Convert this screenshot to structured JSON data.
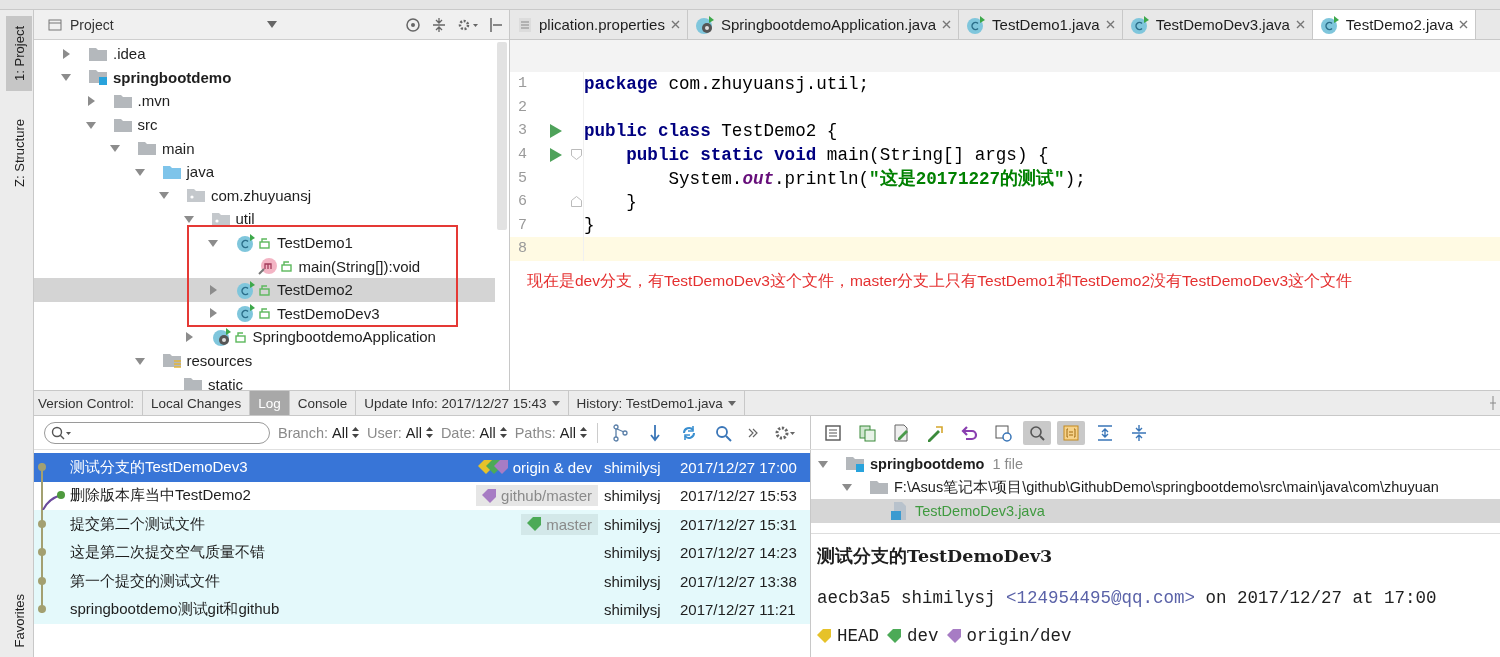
{
  "side_stripe": {
    "tabs": [
      {
        "label": "1: Project",
        "selected": true
      },
      {
        "label": "Z: Structure",
        "selected": false
      }
    ],
    "bottom_tabs": [
      {
        "label": "Favorites",
        "selected": false
      }
    ]
  },
  "project_panel": {
    "title": "Project",
    "tree": [
      {
        "label": ".idea",
        "kind": "folder",
        "expanded": false,
        "selected": false
      },
      {
        "label": "springbootdemo",
        "kind": "module",
        "expanded": true,
        "selected": false,
        "children": [
          {
            "label": ".mvn",
            "kind": "folder",
            "expanded": false,
            "selected": false
          },
          {
            "label": "src",
            "kind": "folder",
            "expanded": true,
            "selected": false,
            "children": [
              {
                "label": "main",
                "kind": "folder",
                "expanded": true,
                "selected": false,
                "children": [
                  {
                    "label": "java",
                    "kind": "source",
                    "expanded": true,
                    "selected": false,
                    "children": [
                      {
                        "label": "com.zhuyuansj",
                        "kind": "package",
                        "expanded": true,
                        "selected": false,
                        "children": [
                          {
                            "label": "util",
                            "kind": "package",
                            "expanded": true,
                            "selected": false,
                            "children": [
                              {
                                "label": "TestDemo1",
                                "kind": "class",
                                "expanded": true,
                                "selected": false,
                                "children": [
                                  {
                                    "label": "main(String[]):void",
                                    "kind": "method",
                                    "selected": false
                                  }
                                ]
                              },
                              {
                                "label": "TestDemo2",
                                "kind": "class",
                                "expanded": false,
                                "selected": true
                              },
                              {
                                "label": "TestDemoDev3",
                                "kind": "class",
                                "expanded": false,
                                "selected": false
                              }
                            ]
                          },
                          {
                            "label": "SpringbootdemoApplication",
                            "kind": "spring",
                            "expanded": false,
                            "selected": false
                          }
                        ]
                      }
                    ]
                  },
                  {
                    "label": "resources",
                    "kind": "resources",
                    "expanded": true,
                    "selected": false,
                    "children": [
                      {
                        "label": "static",
                        "kind": "folder",
                        "selected": false
                      }
                    ]
                  }
                ]
              }
            ]
          }
        ]
      }
    ]
  },
  "editor": {
    "tabs": [
      {
        "label": "plication.properties",
        "kind": "properties",
        "selected": false
      },
      {
        "label": "SpringbootdemoApplication.java",
        "kind": "spring",
        "selected": false
      },
      {
        "label": "TestDemo1.java",
        "kind": "class",
        "selected": false
      },
      {
        "label": "TestDemoDev3.java",
        "kind": "class",
        "selected": false
      },
      {
        "label": "TestDemo2.java",
        "kind": "class",
        "selected": true
      }
    ],
    "lines": [
      {
        "number": "1",
        "kind": "plain",
        "run": false,
        "current": false,
        "tokens": [
          {
            "kind": "keyword",
            "text": "package"
          },
          {
            "kind": "plain",
            "text": " com.zhuyuansj.util;"
          }
        ]
      },
      {
        "number": "2",
        "kind": "plain",
        "run": false,
        "current": false
      },
      {
        "number": "3",
        "kind": "plain",
        "run": true,
        "current": false,
        "tokens": [
          {
            "kind": "keyword",
            "text": "public"
          },
          {
            "kind": "keyword",
            "text": " class"
          },
          {
            "kind": "plain",
            "text": " TestDemo2 {"
          }
        ]
      },
      {
        "number": "4",
        "kind": "fold-start",
        "run": true,
        "current": false,
        "tokens": [
          {
            "kind": "keyword",
            "text": "    public"
          },
          {
            "kind": "keyword",
            "text": " static"
          },
          {
            "kind": "keyword",
            "text": " void"
          },
          {
            "kind": "plain",
            "text": " main(String[] args) {"
          }
        ]
      },
      {
        "number": "5",
        "kind": "plain",
        "run": false,
        "current": false,
        "tokens": [
          {
            "kind": "plain",
            "text": "        System."
          },
          {
            "kind": "field",
            "text": "out"
          },
          {
            "kind": "plain",
            "text": ".println("
          },
          {
            "kind": "string",
            "text": "\"这是20171227的测试\""
          },
          {
            "kind": "plain",
            "text": ");"
          }
        ]
      },
      {
        "number": "6",
        "kind": "fold-end",
        "run": false,
        "current": false,
        "tokens": [
          {
            "kind": "plain",
            "text": "    }"
          }
        ]
      },
      {
        "number": "7",
        "kind": "plain",
        "run": false,
        "current": false,
        "tokens": [
          {
            "kind": "plain",
            "text": "}"
          }
        ]
      },
      {
        "number": "8",
        "kind": "plain",
        "run": false,
        "current": true
      }
    ],
    "annotation": "现在是dev分支，有TestDemoDev3这个文件，master分支上只有TestDemo1和TestDemo2没有TestDemoDev3这个文件"
  },
  "version_control": {
    "label": "Version Control:",
    "tabs": [
      {
        "label": "Local Changes",
        "selected": false,
        "dropdown": false
      },
      {
        "label": "Log",
        "selected": true,
        "dropdown": false
      },
      {
        "label": "Console",
        "selected": false,
        "dropdown": false
      },
      {
        "label": "Update Info: 2017/12/27 15:43",
        "selected": false,
        "dropdown": true
      },
      {
        "label": "History: TestDemo1.java",
        "selected": false,
        "dropdown": true
      }
    ],
    "filters": [
      {
        "label": "Branch:",
        "value": "All"
      },
      {
        "label": "User:",
        "value": "All"
      },
      {
        "label": "Date:",
        "value": "All"
      },
      {
        "label": "Paths:",
        "value": "All"
      }
    ],
    "commits": [
      {
        "message": "测试分支的TestDemoDev3",
        "refs": [
          {
            "label": "origin & dev",
            "tags": [
              {
                "color": "#e6c229"
              },
              {
                "color": "#4caa57"
              },
              {
                "color": "#a77cc4"
              }
            ]
          }
        ],
        "author": "shimilysj",
        "date": "2017/12/27 17:00",
        "selected": true,
        "highlighted": true,
        "kind": "main"
      },
      {
        "message": "删除版本库当中TestDemo2",
        "refs": [
          {
            "label": "github/master",
            "tags": [
              {
                "color": "#a77cc4"
              }
            ]
          }
        ],
        "author": "shimilysj",
        "date": "2017/12/27 15:53",
        "selected": false,
        "highlighted": false,
        "kind": "branch"
      },
      {
        "message": "提交第二个测试文件",
        "refs": [
          {
            "label": "master",
            "tags": [
              {
                "color": "#4caa57"
              }
            ]
          }
        ],
        "author": "shimilysj",
        "date": "2017/12/27 15:31",
        "selected": false,
        "highlighted": true,
        "kind": "main"
      },
      {
        "message": "这是第二次提交空气质量不错",
        "author": "shimilysj",
        "date": "2017/12/27 14:23",
        "selected": false,
        "highlighted": true,
        "kind": "main"
      },
      {
        "message": "第一个提交的测试文件",
        "author": "shimilysj",
        "date": "2017/12/27 13:38",
        "selected": false,
        "highlighted": true,
        "kind": "main"
      },
      {
        "message": "springbootdemo测试git和github",
        "author": "shimilysj",
        "date": "2017/12/27 11:21",
        "selected": false,
        "highlighted": true,
        "kind": "main"
      }
    ]
  },
  "changes": [
    {
      "label": "springbootdemo",
      "count": "1 file",
      "kind": "module",
      "expanded": true,
      "selected": false,
      "children": [
        {
          "label": "F:\\Asus笔记本\\项目\\github\\GithubDemo\\springbootdemo\\src\\main\\java\\com\\zhuyuan",
          "kind": "folder",
          "expanded": true,
          "selected": false,
          "children": [
            {
              "label": "TestDemoDev3.java",
              "kind": "file",
              "selected": true
            }
          ]
        }
      ]
    }
  ],
  "details": {
    "subject": "测试分支的TestDemoDev3",
    "hash": "aecb3a5",
    "author": "shimilysj",
    "email": "<124954495@qq.com>",
    "when": "on 2017/12/27 at 17:00",
    "refs": [
      {
        "label": "HEAD",
        "color": "#e6c229"
      },
      {
        "label": "dev",
        "color": "#4caa57"
      },
      {
        "label": "origin/dev",
        "color": "#a77cc4"
      }
    ]
  }
}
